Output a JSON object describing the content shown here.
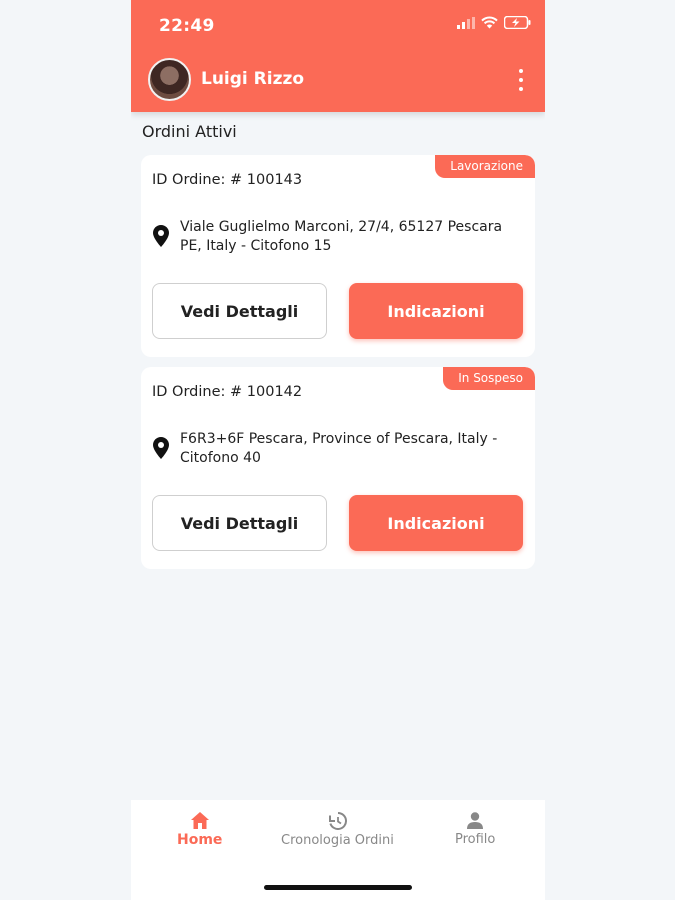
{
  "status_bar": {
    "time": "22:49"
  },
  "header": {
    "user_name": "Luigi Rizzo"
  },
  "main": {
    "section_title": "Ordini Attivi",
    "orders": [
      {
        "badge": "Lavorazione",
        "order_id": "ID Ordine: # 100143",
        "address": "Viale Guglielmo Marconi, 27/4, 65127 Pescara PE, Italy - Citofono 15",
        "details_label": "Vedi Dettagli",
        "directions_label": "Indicazioni"
      },
      {
        "badge": "In Sospeso",
        "order_id": "ID Ordine: # 100142",
        "address": "F6R3+6F Pescara, Province of Pescara, Italy - Citofono 40",
        "details_label": "Vedi Dettagli",
        "directions_label": "Indicazioni"
      }
    ]
  },
  "bottom_nav": {
    "items": [
      {
        "label": "Home",
        "icon": "home-icon",
        "active": true
      },
      {
        "label": "Cronologia Ordini",
        "icon": "history-icon",
        "active": false
      },
      {
        "label": "Profilo",
        "icon": "person-icon",
        "active": false
      }
    ]
  },
  "colors": {
    "accent": "#fb6a56",
    "background": "#f3f6f9"
  }
}
